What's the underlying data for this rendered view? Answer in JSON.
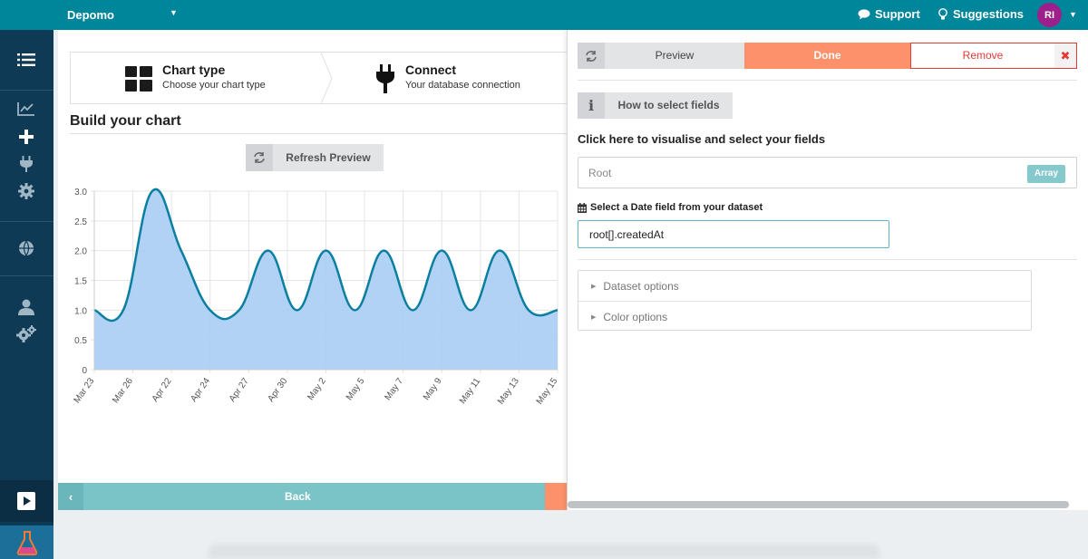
{
  "topbar": {
    "brand": "Depomo",
    "support": "Support",
    "suggestions": "Suggestions",
    "avatar_initials": "RI",
    "color": "#00869a"
  },
  "sidebar": {
    "items": [
      "list-icon",
      "chart-line-icon",
      "plus-icon",
      "plug-icon",
      "gear-icon",
      "globe-icon",
      "user-icon",
      "gears-icon",
      "play-icon",
      "flask-icon"
    ]
  },
  "steps": [
    {
      "title": "Chart type",
      "subtitle": "Choose your chart type",
      "icon": "grid-icon"
    },
    {
      "title": "Connect",
      "subtitle": "Your database connection",
      "icon": "plug-icon"
    }
  ],
  "build": {
    "title": "Build your chart",
    "refresh_label": "Refresh Preview",
    "back_label": "Back"
  },
  "panel": {
    "preview_label": "Preview",
    "done_label": "Done",
    "remove_label": "Remove",
    "howto_label": "How to select fields",
    "click_here": "Click here to visualise and select your fields",
    "root_label": "Root",
    "array_badge": "Array",
    "date_label": "Select a Date field from your dataset",
    "date_value": "root[].createdAt",
    "options": [
      "Dataset options",
      "Color options"
    ]
  },
  "chart_data": {
    "type": "area",
    "x": [
      "Mar 23",
      "Mar 26",
      "Apr 22",
      "Apr 24",
      "Apr 27",
      "Apr 30",
      "May 2",
      "May 5",
      "May 7",
      "May 9",
      "May 11",
      "May 13",
      "May 15"
    ],
    "values": [
      1.0,
      1.0,
      3.0,
      2.0,
      1.0,
      1.0,
      2.0,
      1.0,
      2.0,
      1.0,
      2.0,
      1.0,
      2.0,
      1.0,
      2.0,
      1.0,
      1.0
    ],
    "yticks": [
      "0",
      "0.5",
      "1.0",
      "1.5",
      "2.0",
      "2.5",
      "3.0"
    ],
    "ylim": [
      0,
      3
    ],
    "grid": true,
    "fill_color": "#a9cdf3",
    "line_color": "#0a7fa0"
  }
}
